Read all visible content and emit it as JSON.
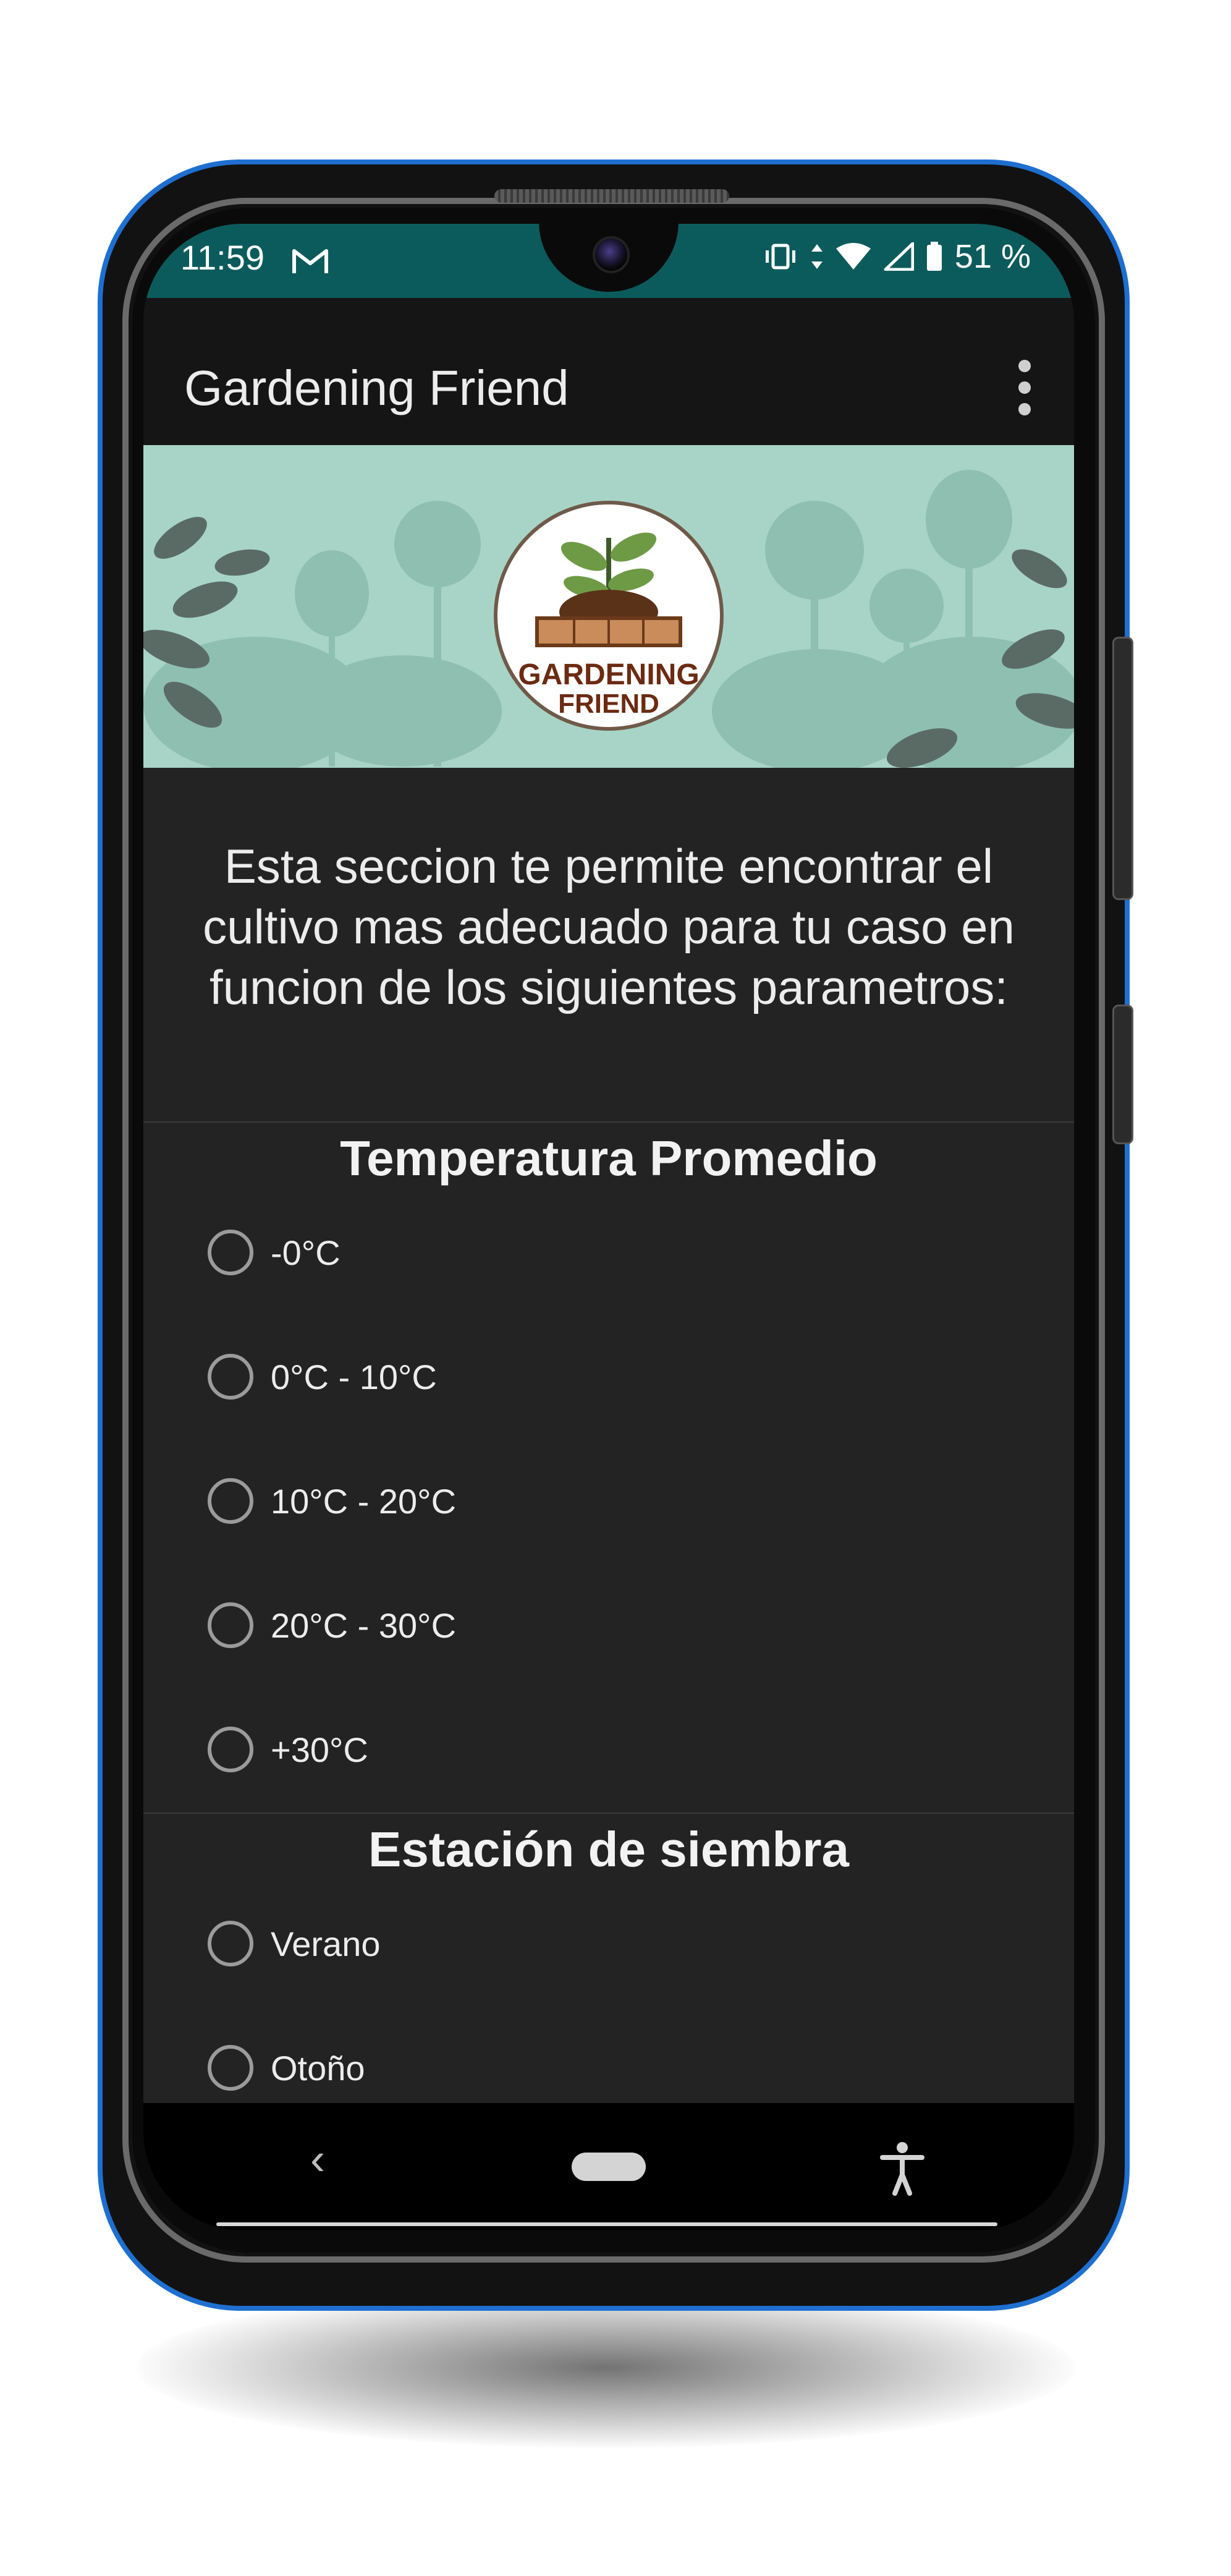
{
  "status_bar": {
    "time": "11:59",
    "battery": "51 %"
  },
  "app_bar": {
    "title": "Gardening Friend"
  },
  "banner": {
    "logo_line1": "GARDENING",
    "logo_line2": "FRIEND"
  },
  "intro_text": "Esta seccion te permite encontrar el cultivo mas adecuado para tu caso en funcion de los siguientes parametros:",
  "temperature": {
    "title": "Temperatura Promedio",
    "options": [
      "-0°C",
      "0°C - 10°C",
      "10°C - 20°C",
      "20°C - 30°C",
      "+30°C"
    ]
  },
  "season": {
    "title": "Estación de siembra",
    "options": [
      "Verano",
      "Otoño"
    ]
  },
  "colors": {
    "status_bar": "#0c5b5c",
    "app_bar": "#151515",
    "screen_bg": "#232323",
    "banner_bg": "#a8d4c7",
    "phone_frame": "#1e6fd0"
  },
  "icons": [
    "gmail-icon",
    "vibrate-icon",
    "data-arrows-icon",
    "wifi-icon",
    "signal-icon",
    "battery-icon",
    "more-vert-icon",
    "back-icon",
    "home-pill-icon",
    "accessibility-icon"
  ]
}
